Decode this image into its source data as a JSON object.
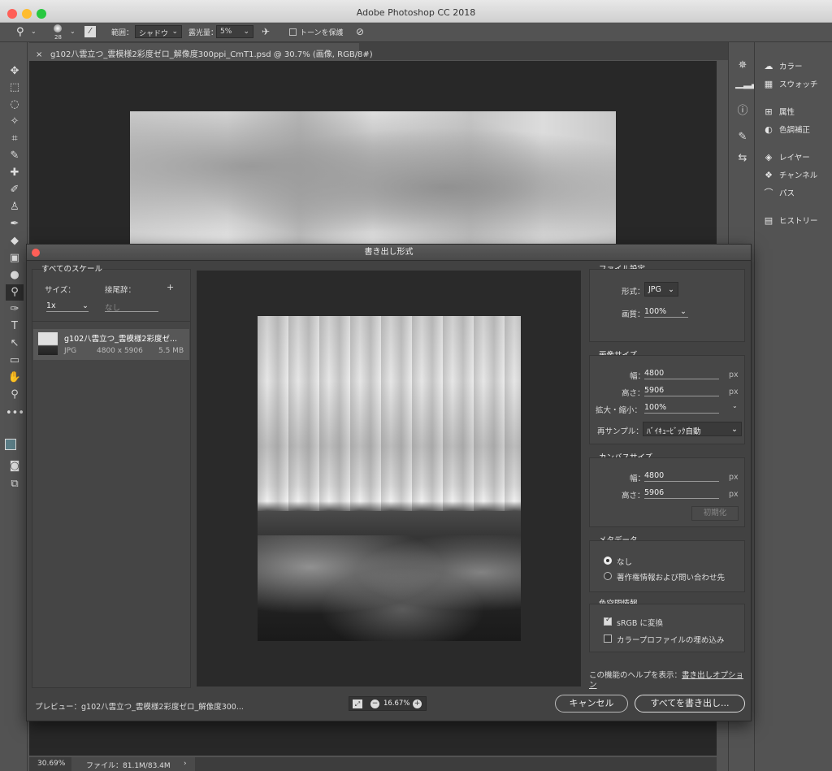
{
  "window": {
    "title": "Adobe Photoshop CC 2018"
  },
  "options_bar": {
    "brush_size": "28",
    "range_label": "範囲：",
    "range_value": "シャドウ",
    "exposure_label": "露光量：",
    "exposure_value": "5%",
    "protect_tones_label": "トーンを保護"
  },
  "document_tab": {
    "close_glyph": "×",
    "title": "g102八雲立つ_雲模様2彩度ゼロ_解像度300ppi_CmT1.psd @ 30.7% (画像, RGB/8#)"
  },
  "status_bar": {
    "zoom": "30.69%",
    "file_info": "ファイル：81.1M/83.4M"
  },
  "panels": [
    {
      "label": "カラー",
      "icon": "color-wheel-icon"
    },
    {
      "label": "スウォッチ",
      "icon": "swatches-grid-icon"
    },
    {
      "label": "属性",
      "icon": "properties-icon"
    },
    {
      "label": "色調補正",
      "icon": "adjustments-icon"
    },
    {
      "label": "レイヤー",
      "icon": "layers-icon"
    },
    {
      "label": "チャンネル",
      "icon": "channels-icon"
    },
    {
      "label": "パス",
      "icon": "paths-icon"
    },
    {
      "label": "ヒストリー",
      "icon": "history-icon"
    }
  ],
  "dialog": {
    "title": "書き出し形式",
    "scales": {
      "heading": "すべてのスケール",
      "size_label": "サイズ：",
      "suffix_label": "接尾辞：",
      "add_glyph": "+",
      "size_value": "1x",
      "suffix_placeholder": "なし"
    },
    "asset": {
      "name": "g102八雲立つ_雲模様2彩度ゼ...",
      "format": "JPG",
      "dimensions": "4800 x 5906",
      "size": "5.5 MB"
    },
    "file_settings": {
      "heading": "ファイル設定",
      "format_label": "形式：",
      "format_value": "JPG",
      "quality_label": "画質：",
      "quality_value": "100%"
    },
    "image_size": {
      "heading": "画像サイズ",
      "width_label": "幅：",
      "width_value": "4800",
      "height_label": "高さ：",
      "height_value": "5906",
      "scale_label": "拡大・縮小：",
      "scale_value": "100%",
      "resample_label": "再サンプル：",
      "resample_value": "ﾊﾞｲｷｭｰﾋﾞｯｸ自動",
      "unit": "px"
    },
    "canvas_size": {
      "heading": "カンバスサイズ",
      "width_label": "幅：",
      "width_value": "4800",
      "height_label": "高さ：",
      "height_value": "5906",
      "unit": "px",
      "reset_label": "初期化"
    },
    "metadata": {
      "heading": "メタデータ",
      "option_none": "なし",
      "option_copyright": "著作権情報および問い合わせ先",
      "selected": "none"
    },
    "color_space": {
      "heading": "色空間情報",
      "srgb_label": "sRGB に変換",
      "srgb_checked": true,
      "embed_label": "カラープロファイルの埋め込み",
      "embed_checked": false
    },
    "help": {
      "prefix": "この機能のヘルプを表示：",
      "link1": "書き出しオプショ",
      "link2": "ン"
    },
    "footer": {
      "preview_label": "プレビュー：g102八雲立つ_雲模様2彩度ゼロ_解像度300...",
      "zoom_value": "16.67%",
      "cancel_label": "キャンセル",
      "export_label": "すべてを書き出し..."
    }
  }
}
